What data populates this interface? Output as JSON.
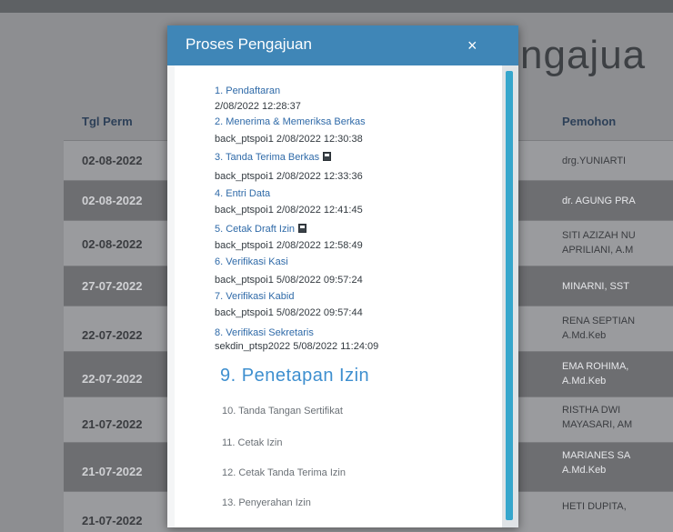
{
  "background": {
    "title_fragment": "ngajua",
    "columns": {
      "date": "Tgl Perm",
      "applicant": "Pemohon"
    },
    "rows": [
      {
        "date": "02-08-2022",
        "name_lines": [
          "drg.YUNIARTI"
        ]
      },
      {
        "date": "02-08-2022",
        "name_lines": [
          "dr. AGUNG PRA"
        ]
      },
      {
        "date": "02-08-2022",
        "name_lines": [
          "SITI AZIZAH NU",
          "APRILIANI, A.M"
        ]
      },
      {
        "date": "27-07-2022",
        "name_lines": [
          "MINARNI, SST"
        ]
      },
      {
        "date": "22-07-2022",
        "name_lines": [
          "RENA SEPTIAN",
          "A.Md.Keb"
        ]
      },
      {
        "date": "22-07-2022",
        "name_lines": [
          "EMA ROHIMA,",
          "A.Md.Keb"
        ]
      },
      {
        "date": "21-07-2022",
        "name_lines": [
          "RISTHA DWI",
          "MAYASARI, AM"
        ]
      },
      {
        "date": "21-07-2022",
        "name_lines": [
          "MARIANES SA",
          "A.Md.Keb"
        ]
      },
      {
        "date": "21-07-2022",
        "name_lines": [
          "HETI DUPITA,"
        ]
      }
    ]
  },
  "modal": {
    "title": "Proses Pengajuan",
    "close_label": "×",
    "completed_steps": [
      {
        "label": "1. Pendaftaran",
        "meta": "2/08/2022 12:28:37",
        "has_file_icon": false
      },
      {
        "label": "2. Menerima & Memeriksa Berkas",
        "meta": "back_ptspoi1 2/08/2022 12:30:38",
        "has_file_icon": false
      },
      {
        "label": "3. Tanda Terima Berkas",
        "meta": "back_ptspoi1 2/08/2022 12:33:36",
        "has_file_icon": true
      },
      {
        "label": "4. Entri Data",
        "meta": "back_ptspoi1 2/08/2022 12:41:45",
        "has_file_icon": false
      },
      {
        "label": "5. Cetak Draft Izin",
        "meta": "back_ptspoi1 2/08/2022 12:58:49",
        "has_file_icon": true
      },
      {
        "label": "6. Verifikasi Kasi",
        "meta": "back_ptspoi1 5/08/2022 09:57:24",
        "has_file_icon": false
      },
      {
        "label": "7. Verifikasi Kabid",
        "meta": "back_ptspoi1 5/08/2022 09:57:44",
        "has_file_icon": false
      },
      {
        "label": "8. Verifikasi Sekretaris",
        "meta": "sekdin_ptsp2022 5/08/2022 11:24:09",
        "has_file_icon": false
      }
    ],
    "current_step": "9. Penetapan Izin",
    "pending_steps": [
      "10. Tanda Tangan Sertifikat",
      "11. Cetak Izin",
      "12. Cetak Tanda Terima Izin",
      "13. Penyerahan Izin"
    ]
  },
  "colors": {
    "modal_header": "#3f86b7",
    "step_link": "#2f6aa8",
    "current_step": "#3e8fcf",
    "scrollbar_thumb": "#35a6cc"
  },
  "icons": {
    "close": "close-icon",
    "file": "file-icon"
  }
}
